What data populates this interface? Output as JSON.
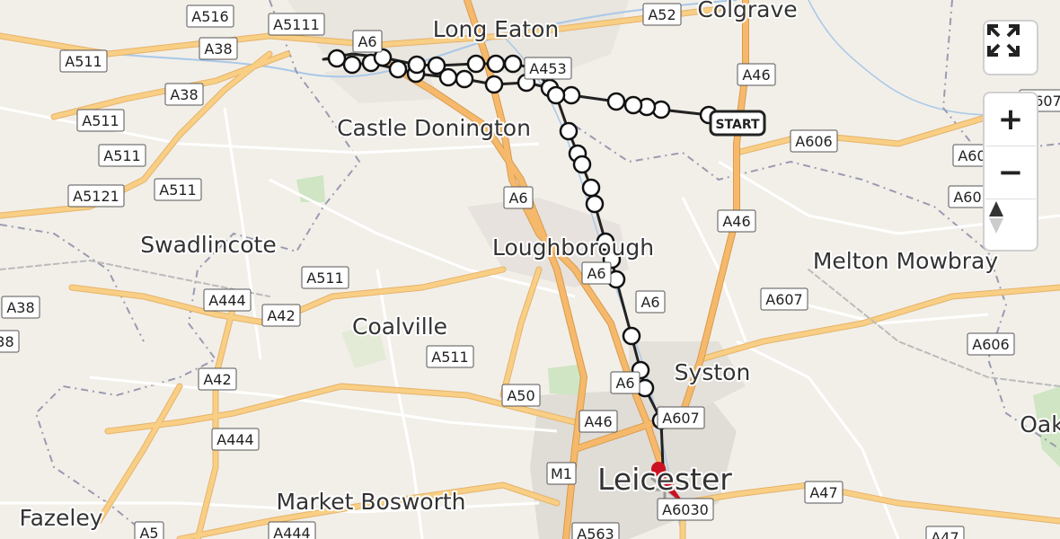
{
  "map": {
    "places": [
      {
        "name": "Long Eaton",
        "size": "large"
      },
      {
        "name": "Colgrave",
        "size": "large"
      },
      {
        "name": "Castle Donington",
        "size": "large"
      },
      {
        "name": "Swadlincote",
        "size": "large"
      },
      {
        "name": "Loughborough",
        "size": "large"
      },
      {
        "name": "Melton Mowbray",
        "size": "large"
      },
      {
        "name": "Coalville",
        "size": "large"
      },
      {
        "name": "Syston",
        "size": "large"
      },
      {
        "name": "Leicester",
        "size": "xlarge"
      },
      {
        "name": "Market Bosworth",
        "size": "large"
      },
      {
        "name": "Fazeley",
        "size": "large"
      },
      {
        "name": "Oak",
        "size": "large"
      }
    ],
    "road_labels": [
      "A516",
      "A5111",
      "A6",
      "A52",
      "A38",
      "A511",
      "A46",
      "A38",
      "A511",
      "A453",
      "A511",
      "A607",
      "A606",
      "A5121",
      "A511",
      "A6",
      "A46",
      "A60",
      "A60",
      "A38",
      "A511",
      "A6",
      "A444",
      "A42",
      "A607",
      "A38",
      "A6",
      "A606",
      "A511",
      "A42",
      "A6",
      "A50",
      "A46",
      "A607",
      "A444",
      "M1",
      "A47",
      "A6030",
      "A5",
      "A444",
      "A563",
      "A47"
    ],
    "route": {
      "start_label": "START",
      "stop_count": 37,
      "route_color": "#222222",
      "destination_color": "#cc1122"
    }
  },
  "controls": {
    "fullscreen_icon": "fullscreen-icon",
    "zoom_in_label": "+",
    "zoom_out_label": "−",
    "north_icon": "compass-north-icon"
  }
}
